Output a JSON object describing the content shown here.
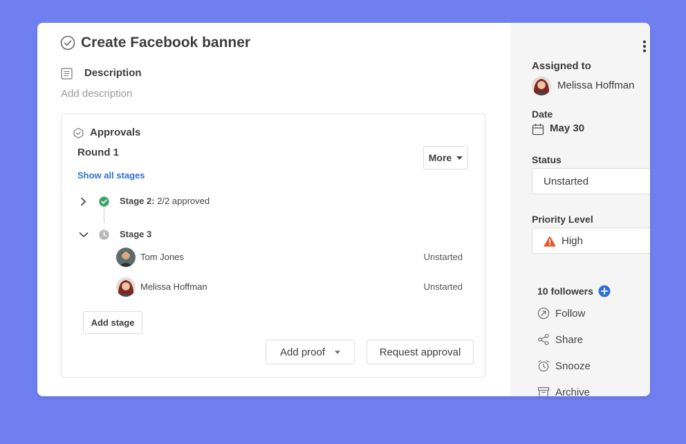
{
  "task": {
    "title": "Create Facebook banner",
    "description_label": "Description",
    "description_placeholder": "Add description"
  },
  "approvals": {
    "heading": "Approvals",
    "round": "Round 1",
    "more_label": "More",
    "show_all_stages": "Show all stages",
    "stage2": {
      "label": "Stage 2:",
      "summary": "2/2 approved"
    },
    "stage3": {
      "label": "Stage 3",
      "approvers": [
        {
          "name": "Tom Jones",
          "status": "Unstarted"
        },
        {
          "name": "Melissa Hoffman",
          "status": "Unstarted"
        }
      ]
    },
    "add_stage": "Add stage",
    "add_proof": "Add proof",
    "request_approval": "Request approval"
  },
  "sidebar": {
    "assigned_label": "Assigned to",
    "assignee": "Melissa Hoffman",
    "date_label": "Date",
    "date_value": "May 30",
    "status_label": "Status",
    "status_value": "Unstarted",
    "priority_label": "Priority Level",
    "priority_value": "High",
    "followers": "10 followers",
    "actions": [
      "Follow",
      "Share",
      "Snooze",
      "Archive"
    ]
  },
  "colors": {
    "background": "#6f7ff0",
    "approved": "#3fa46a",
    "link": "#2f6fd6",
    "priority_high": "#e4572e"
  },
  "icons": [
    "check-circle-icon",
    "description-icon",
    "approvals-icon",
    "chevron-right-icon",
    "chevron-down-icon",
    "check-icon",
    "clock-icon",
    "calendar-icon",
    "warning-icon",
    "plus-icon",
    "follow-icon",
    "share-icon",
    "snooze-icon",
    "archive-icon",
    "more-vertical-icon",
    "caret-down-icon"
  ]
}
